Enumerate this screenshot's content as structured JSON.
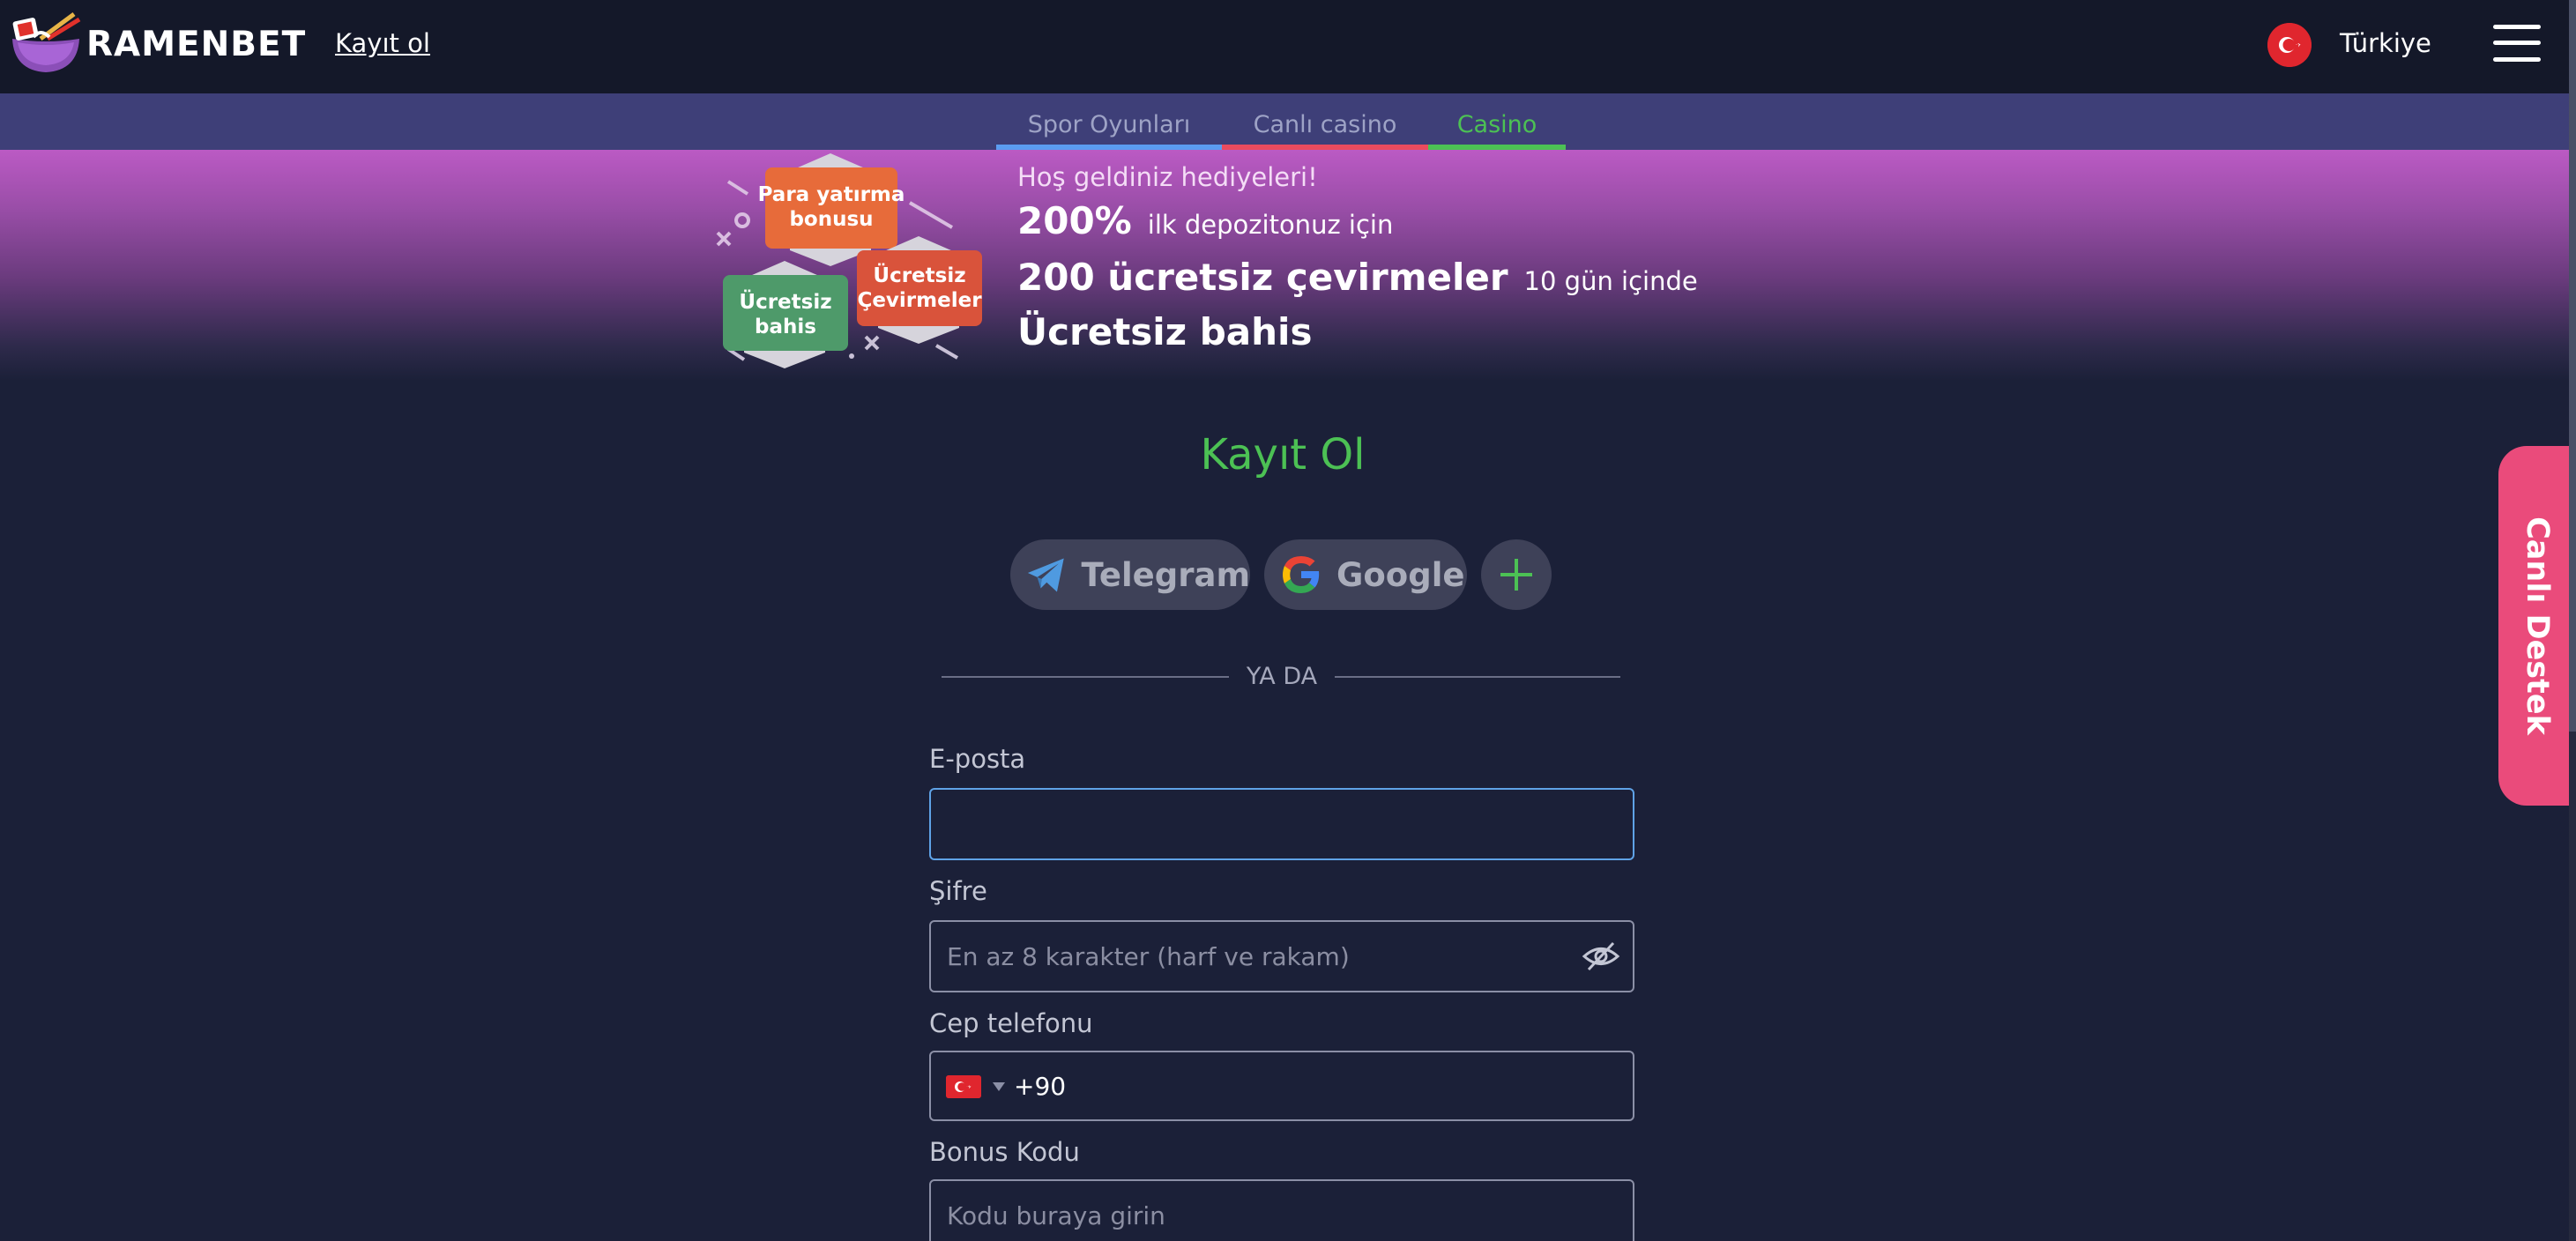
{
  "header": {
    "brand": "RAMENBET",
    "register_link": "Kayıt ol",
    "country": "Türkiye",
    "icons": [
      "ramen-logo-icon",
      "turkey-flag-icon",
      "hamburger-menu-icon"
    ]
  },
  "tabs": [
    {
      "label": "Spor Oyunları",
      "color": "#5b9cf0"
    },
    {
      "label": "Canlı casino",
      "color": "#ea4b5e"
    },
    {
      "label": "Casino",
      "color": "#4cc154",
      "active": true
    }
  ],
  "promo": {
    "welcome": "Hoş geldiniz hediyeleri!",
    "line1_big": "200%",
    "line1_small": "ilk depozitonuz için",
    "line2_big": "200 ücretsiz çevirmeler",
    "line2_small": "10 gün içinde",
    "line3_big": "Ücretsiz bahis",
    "badge_deposit_1": "Para yatırma",
    "badge_deposit_2": "bonusu",
    "badge_spins_1": "Ücretsiz",
    "badge_spins_2": "Çevirmeler",
    "badge_bet_1": "Ücretsiz",
    "badge_bet_2": "bahis"
  },
  "form": {
    "title": "Kayıt Ol",
    "telegram": "Telegram",
    "google": "Google",
    "divider": "YA DA",
    "email_label": "E-posta",
    "email_value": "",
    "password_label": "Şifre",
    "password_placeholder": "En az 8 karakter (harf ve rakam)",
    "phone_label": "Cep telefonu",
    "phone_code": "+90",
    "bonus_label": "Bonus Kodu",
    "bonus_placeholder": "Kodu buraya girin"
  },
  "support": {
    "label": "Canlı Destek"
  },
  "colors": {
    "background": "#1b2038",
    "header": "#141829",
    "tabs_bar": "#3e3f78",
    "accent_green": "#4cc154",
    "support_pink": "#ea4b7b",
    "input_focus": "#5fa2e6"
  }
}
